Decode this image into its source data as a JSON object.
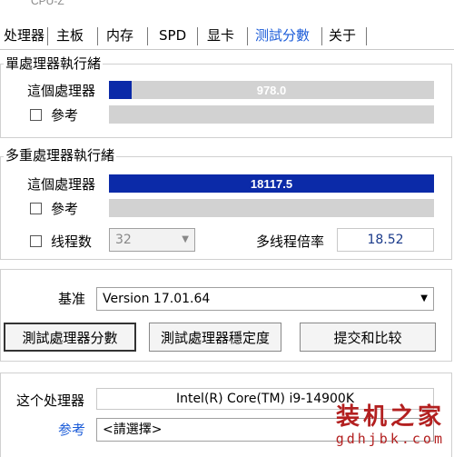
{
  "window": {
    "title": "CPU-Z"
  },
  "tabs": [
    {
      "label": "处理器"
    },
    {
      "label": "主板"
    },
    {
      "label": "内存"
    },
    {
      "label": "SPD"
    },
    {
      "label": "显卡"
    },
    {
      "label": "测試分數"
    },
    {
      "label": "关于"
    }
  ],
  "active_tab": "测試分數",
  "single_thread": {
    "group_label": "單處理器執行緒",
    "this_processor": {
      "label": "這個處理器",
      "value": "978.0",
      "fraction": 0.07
    },
    "reference": {
      "label": "參考"
    }
  },
  "multi_thread": {
    "group_label": "多重處理器執行緒",
    "this_processor": {
      "label": "這個處理器",
      "value": "18117.5",
      "fraction": 1.0
    },
    "reference": {
      "label": "參考"
    },
    "threads": {
      "label": "线程数",
      "value": "32"
    },
    "ratio": {
      "label": "多线程倍率",
      "value": "18.52"
    }
  },
  "benchmark": {
    "label": "基准",
    "version": "Version 17.01.64",
    "buttons": {
      "bench": "測試處理器分數",
      "stress": "測試處理器穩定度",
      "submit": "提交和比较"
    }
  },
  "compare": {
    "this_processor_label": "这个处理器",
    "this_processor_value": "Intel(R) Core(TM) i9-14900K",
    "reference_label": "参考",
    "reference_value": "<請選擇>"
  },
  "watermark": {
    "line1": "装机之家",
    "line2": "gdhjbk.com"
  },
  "colors": {
    "single_bar": "#0b2aa8",
    "multi_bar": "#0b2aa8",
    "bar_bg": "#d2d2d2",
    "watermark": "#b32020",
    "link": "#1a5bd8"
  }
}
